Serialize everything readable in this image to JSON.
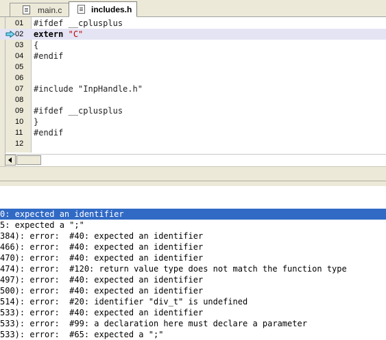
{
  "tabs": [
    {
      "label": "main.c",
      "active": false
    },
    {
      "label": "includes.h",
      "active": true
    }
  ],
  "editor": {
    "current_line": 1,
    "lines": [
      {
        "num": "01",
        "text": "#ifdef __cplusplus"
      },
      {
        "num": "02",
        "kw": "extern",
        "str": "\"C\""
      },
      {
        "num": "03",
        "text": "{"
      },
      {
        "num": "04",
        "text": "#endif"
      },
      {
        "num": "05",
        "text": ""
      },
      {
        "num": "06",
        "text": ""
      },
      {
        "num": "07",
        "text": "#include \"InpHandle.h\""
      },
      {
        "num": "08",
        "text": ""
      },
      {
        "num": "09",
        "text": "#ifdef __cplusplus"
      },
      {
        "num": "10",
        "text": "}"
      },
      {
        "num": "11",
        "text": "#endif"
      },
      {
        "num": "12",
        "text": ""
      }
    ]
  },
  "output": {
    "lines": [
      {
        "text": "0: expected an identifier",
        "selected": true
      },
      {
        "text": "5: expected a \";\"",
        "selected": false
      },
      {
        "text": "384): error:  #40: expected an identifier",
        "selected": false
      },
      {
        "text": "466): error:  #40: expected an identifier",
        "selected": false
      },
      {
        "text": "470): error:  #40: expected an identifier",
        "selected": false
      },
      {
        "text": "474): error:  #120: return value type does not match the function type",
        "selected": false
      },
      {
        "text": "497): error:  #40: expected an identifier",
        "selected": false
      },
      {
        "text": "500): error:  #40: expected an identifier",
        "selected": false
      },
      {
        "text": "514): error:  #20: identifier \"div_t\" is undefined",
        "selected": false
      },
      {
        "text": "533): error:  #40: expected an identifier",
        "selected": false
      },
      {
        "text": "533): error:  #99: a declaration here must declare a parameter",
        "selected": false
      },
      {
        "text": "533): error:  #65: expected a \";\"",
        "selected": false
      }
    ]
  },
  "colors": {
    "selection": "#316ac5",
    "current_line": "#e4e4f4",
    "string": "#c00000",
    "chrome": "#ece9d8"
  }
}
